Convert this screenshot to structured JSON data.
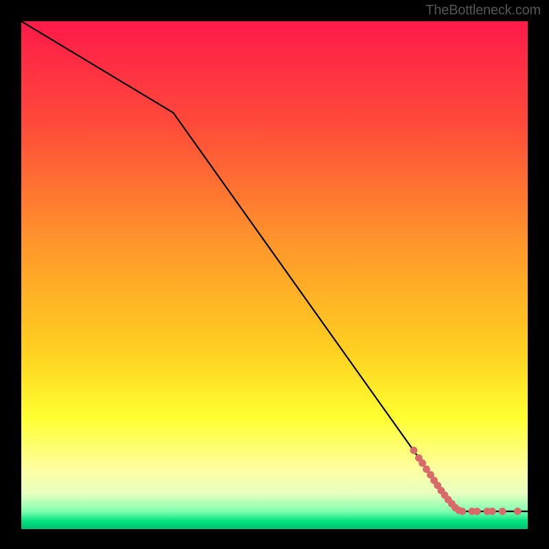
{
  "attribution": "TheBottleneck.com",
  "chart_data": {
    "type": "line",
    "title": "",
    "xlabel": "",
    "ylabel": "",
    "xlim": [
      0,
      100
    ],
    "ylim": [
      0,
      100
    ],
    "gradient_stops": [
      {
        "offset": 0.0,
        "color": "#ff1a4a"
      },
      {
        "offset": 0.2,
        "color": "#ff4a3a"
      },
      {
        "offset": 0.45,
        "color": "#ff9a2a"
      },
      {
        "offset": 0.65,
        "color": "#ffd020"
      },
      {
        "offset": 0.78,
        "color": "#ffff30"
      },
      {
        "offset": 0.88,
        "color": "#ffffa0"
      },
      {
        "offset": 0.93,
        "color": "#e8ffc0"
      },
      {
        "offset": 0.965,
        "color": "#80ffb0"
      },
      {
        "offset": 0.985,
        "color": "#00e080"
      },
      {
        "offset": 1.0,
        "color": "#00c070"
      }
    ],
    "line": {
      "x": [
        0,
        30,
        86,
        100
      ],
      "y": [
        100,
        82,
        3.5,
        3.5
      ]
    },
    "scatter": {
      "x": [
        77.5,
        78.5,
        79.2,
        80.0,
        80.8,
        81.5,
        82.2,
        82.9,
        83.6,
        84.3,
        85.0,
        85.7,
        86.4,
        87.1,
        89.0,
        90.0,
        92.0,
        93.0,
        95.0,
        98.0
      ],
      "y": [
        15.5,
        14.0,
        13.0,
        11.8,
        10.7,
        9.6,
        8.6,
        7.6,
        6.7,
        5.8,
        5.0,
        4.2,
        3.7,
        3.5,
        3.5,
        3.5,
        3.5,
        3.5,
        3.5,
        3.5
      ],
      "color": "#d86a6a",
      "radius": 5.4
    }
  }
}
